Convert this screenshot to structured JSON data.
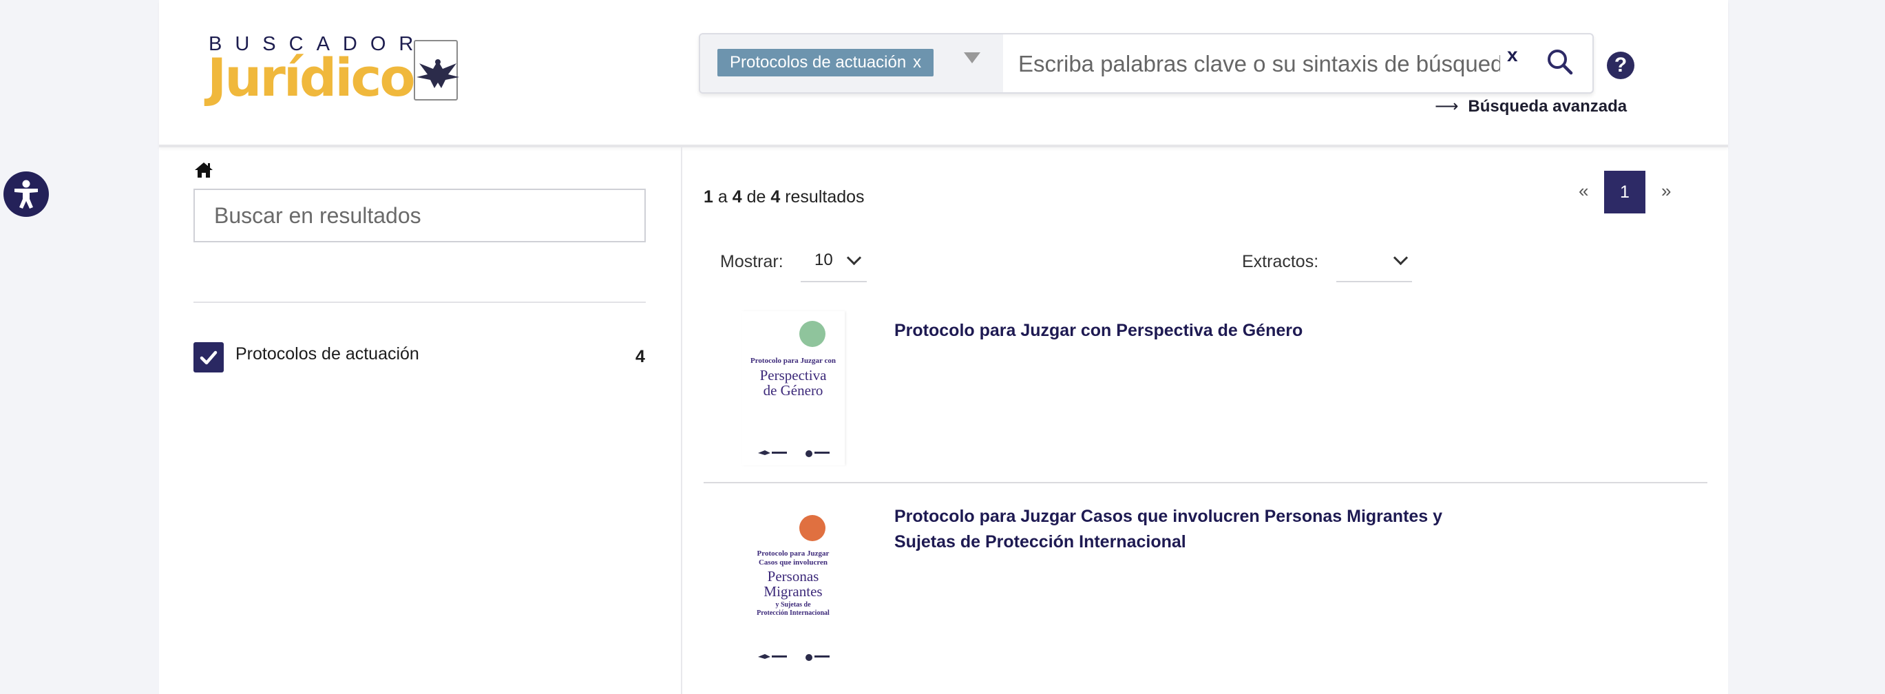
{
  "header": {
    "logo_top": "BUSCADOR",
    "logo_main": "Jurídico",
    "search": {
      "chip_label": "Protocolos de actuación",
      "chip_remove": "x",
      "placeholder": "Escriba palabras clave o su sintaxis de búsqued",
      "clear": "x"
    },
    "help": "?",
    "advanced_search": "Búsqueda avanzada",
    "advanced_arrow": "⟶"
  },
  "sidebar": {
    "filter_placeholder": "Buscar en resultados",
    "facets": [
      {
        "label": "Protocolos de actuación",
        "count": "4",
        "checked": true
      }
    ]
  },
  "results": {
    "summary": {
      "from": "1",
      "a": "a",
      "to": "4",
      "de": "de",
      "total": "4",
      "word": "resultados"
    },
    "pagination": {
      "prev": "«",
      "current": "1",
      "next": "»"
    },
    "show_label": "Mostrar:",
    "show_value": "10",
    "extracts_label": "Extractos:",
    "extracts_value": "",
    "items": [
      {
        "title": "Protocolo para Juzgar con Perspectiva de Género",
        "cover": {
          "small": "Protocolo para Juzgar con",
          "big1": "Perspectiva",
          "big2": "de Género",
          "dot_color": "#8fc49c"
        }
      },
      {
        "title": "Protocolo para Juzgar Casos que involucren Personas Migrantes y Sujetas de Protección Internacional",
        "cover": {
          "small1": "Protocolo para Juzgar",
          "small2": "Casos que involucren",
          "big1": "Personas",
          "big2": "Migrantes",
          "tiny1": "y Sujetas de",
          "tiny2": "Protección Internacional",
          "dot_color": "#e07040"
        }
      }
    ]
  },
  "colors": {
    "brand_navy": "#2d2a66",
    "logo_gold": "#f0b83c",
    "chip_blue": "#6d94ae"
  }
}
